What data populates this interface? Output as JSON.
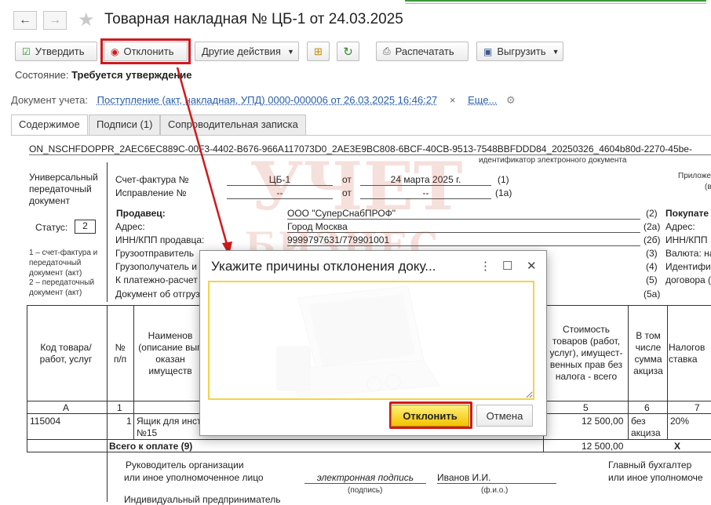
{
  "window": {
    "title": "Товарная накладная № ЦБ-1 от 24.03.2025",
    "back": "←",
    "forward": "→",
    "star": "★"
  },
  "toolbar": {
    "approve": "Утвердить",
    "reject": "Отклонить",
    "other": "Другие действия",
    "print": "Распечатать",
    "export": "Выгрузить"
  },
  "status": {
    "label": "Состояние:",
    "value": "Требуется утверждение"
  },
  "accounting": {
    "label": "Документ учета:",
    "link": "Поступление (акт, накладная, УПД) 0000-000006 от 26.03.2025 16:46:27",
    "clear": "×",
    "more": "Еще..."
  },
  "tabs": [
    "Содержимое",
    "Подписи (1)",
    "Сопроводительная записка"
  ],
  "doc": {
    "file_id": "ON_NSCHFDOPPR_2AEC6EC889C-00F3-4402-B676-966A117073D0_2AE3E9BC808-6BCF-40CB-9513-7548BBFDDD84_20250326_4604b80d-2270-45be-",
    "file_id_caption": "идентификатор электронного документа",
    "upd_title": "Универсальный передаточный документ",
    "status_label": "Статус:",
    "status_value": "2",
    "status_note1": "1 – счет-фактура и передаточный документ (акт)",
    "status_note2": "2 – передаточный документ (акт)",
    "appendix": "Приложе",
    "appendix2": "(в",
    "invoice_label": "Счет-фактура №",
    "invoice_no": "ЦБ-1",
    "from": "от",
    "invoice_date": "24 марта 2025 г.",
    "n1": "(1)",
    "correction_label": "Исправление №",
    "correction_no": "--",
    "correction_date": "--",
    "n1a": "(1а)",
    "seller_label": "Продавец:",
    "seller": "ООО \"СуперСнабПРОФ\"",
    "n2": "(2)",
    "address_label": "Адрес:",
    "address": "Город Москва",
    "n2a": "(2а)",
    "inn_label": "ИНН/КПП продавца:",
    "inn": "9999797631/779901001",
    "n2b": "(2б)",
    "shipper_label": "Грузоотправитель",
    "n3": "(3)",
    "consignee_label": "Грузополучатель и",
    "n4": "(4)",
    "payment_label": "К платежно-расчет",
    "n5": "(5)",
    "shipment_label": "Документ об отгруз",
    "n5a": "(5а)",
    "buyer_label": "Покупате",
    "buyer_addr": "Адрес:",
    "buyer_inn": "ИНН/КПП",
    "currency": "Валюта: на",
    "ident": "Идентифи",
    "contract": "договора (",
    "col_code": "Код товара/ работ, услуг",
    "col_num": "№ п/п",
    "col_name": "Наименов (описание вып оказан имуществ",
    "col_cost": "Стоимость товаров (работ, услуг), имущест- венных прав без налога - всего",
    "col_excise": "В том числе сумма акциза",
    "col_tax": "Налогов ставка",
    "idx_a": "А",
    "idx_1": "1",
    "idx_5": "5",
    "idx_6": "6",
    "idx_7": "7",
    "row_code": "115004",
    "row_num": "1",
    "row_name1": "Ящик для инст",
    "row_name2": "№15",
    "row_cost": "12 500,00",
    "row_excise1": "без",
    "row_excise2": "акциза",
    "row_tax": "20%",
    "total_label": "Всего к оплате (9)",
    "total_cost": "12 500,00",
    "total_x": "X",
    "head_label1": "Руководитель организации",
    "head_label2": "или иное уполномоченное лицо",
    "e_sign": "электронная подпись",
    "signer": "Иванов И.И.",
    "sign_caption": "(подпись)",
    "fio_caption": "(ф.и.о.)",
    "chief_acc1": "Главный бухгалтер",
    "chief_acc2": "или иное уполномоче",
    "ip_label": "Индивидуальный предприниматель"
  },
  "watermark": {
    "line1": "УЧЕТ",
    "line2": "БИЗНЕС"
  },
  "dialog": {
    "title": "Укажите причины отклонения доку...",
    "more": "⋮",
    "maximize": "☐",
    "close": "✕",
    "reason_value": "",
    "confirm": "Отклонить",
    "cancel": "Отмена"
  }
}
